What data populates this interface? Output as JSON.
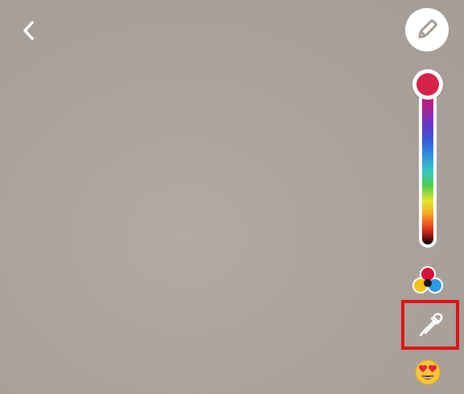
{
  "colors": {
    "selected": "#d6234b",
    "highlight_box": "#e01219",
    "icon": "#ffffff"
  },
  "toolbar": {
    "back_icon": "chevron-left-icon",
    "pencil_icon": "pencil-icon",
    "palette_icon": "color-palette-icon",
    "eyedropper_icon": "eyedropper-icon",
    "emoji_icon": "heart-eyes-emoji-icon"
  },
  "color_slider": {
    "selected_position": 0.0
  }
}
